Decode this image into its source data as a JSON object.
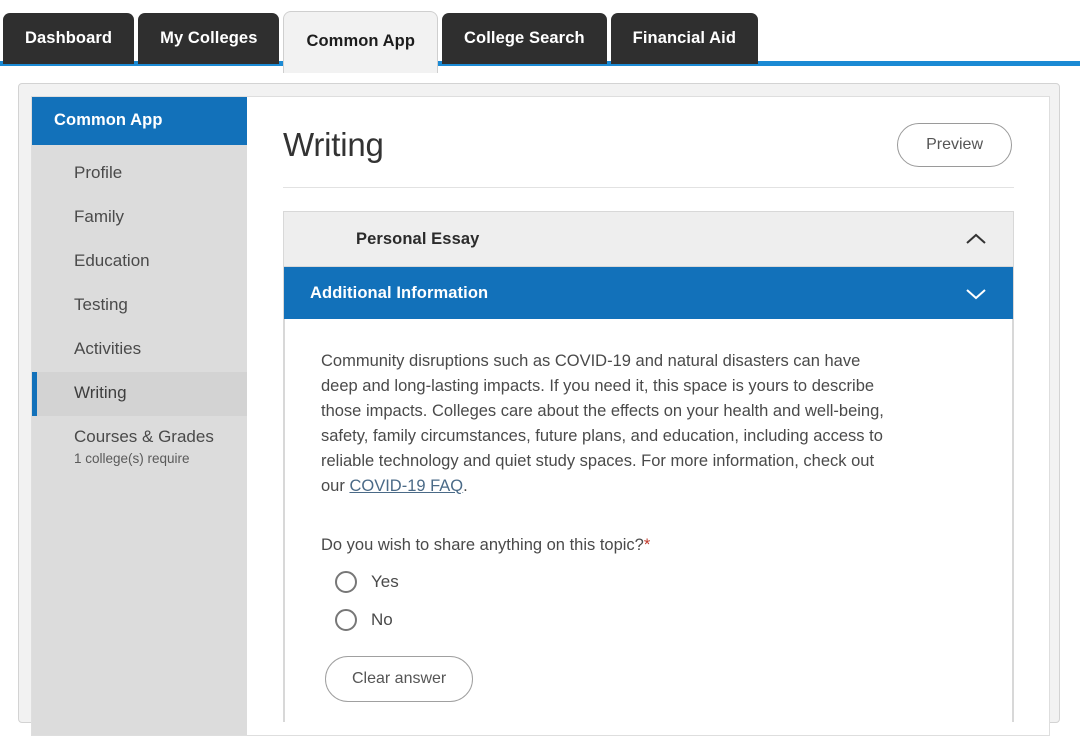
{
  "tabs": [
    {
      "label": "Dashboard",
      "active": false
    },
    {
      "label": "My Colleges",
      "active": false
    },
    {
      "label": "Common App",
      "active": true
    },
    {
      "label": "College Search",
      "active": false
    },
    {
      "label": "Financial Aid",
      "active": false
    }
  ],
  "sidebar": {
    "header": "Common App",
    "items": [
      {
        "label": "Profile",
        "sub": "",
        "active": false
      },
      {
        "label": "Family",
        "sub": "",
        "active": false
      },
      {
        "label": "Education",
        "sub": "",
        "active": false
      },
      {
        "label": "Testing",
        "sub": "",
        "active": false
      },
      {
        "label": "Activities",
        "sub": "",
        "active": false
      },
      {
        "label": "Writing",
        "sub": "",
        "active": true
      },
      {
        "label": "Courses & Grades",
        "sub": "1 college(s) require",
        "active": false
      }
    ]
  },
  "main": {
    "title": "Writing",
    "preview_label": "Preview",
    "sections": [
      {
        "title": "Personal Essay",
        "expanded": false,
        "chevron": "chevron-up-icon"
      },
      {
        "title": "Additional Information",
        "expanded": true,
        "chevron": "chevron-down-icon"
      }
    ],
    "body": {
      "paragraph_part1": "Community disruptions such as COVID-19 and natural disasters can have deep and long-lasting impacts. If you need it, this space is yours to describe those impacts. Colleges care about the effects on your health and well-being, safety, family circumstances, future plans, and education, including access to reliable technology and quiet study spaces. For more information, check out our ",
      "link_text": "COVID-19 FAQ",
      "paragraph_part2": ".",
      "question": "Do you wish to share anything on this topic?",
      "required_marker": "*",
      "options": [
        {
          "label": "Yes",
          "selected": false
        },
        {
          "label": "No",
          "selected": false
        }
      ],
      "clear_label": "Clear answer"
    }
  },
  "colors": {
    "accent_blue": "#1271ba",
    "rule_blue": "#1b8ad4",
    "tab_dark": "#2f2f2f",
    "sidebar_gray": "#dcdcdc",
    "required_red": "#c0392b",
    "link_blue": "#4a6a87"
  }
}
